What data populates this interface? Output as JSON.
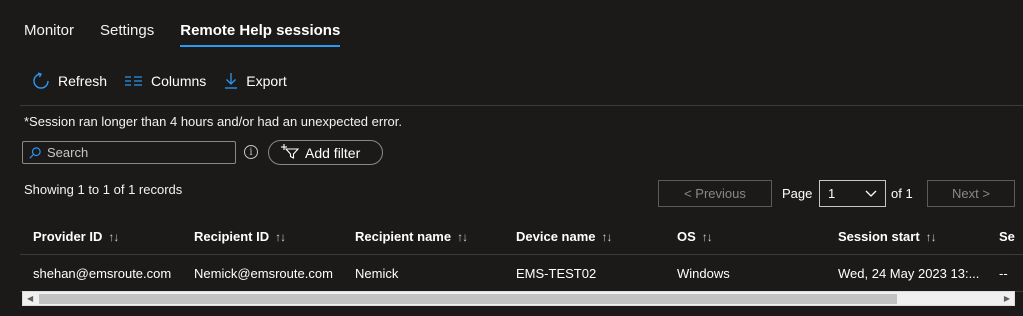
{
  "tabs": [
    {
      "label": "Monitor",
      "active": false
    },
    {
      "label": "Settings",
      "active": false
    },
    {
      "label": "Remote Help sessions",
      "active": true
    }
  ],
  "toolbar": {
    "refresh_label": "Refresh",
    "columns_label": "Columns",
    "export_label": "Export"
  },
  "note": "*Session ran longer than 4 hours and/or had an unexpected error.",
  "search": {
    "placeholder": "Search",
    "value": ""
  },
  "filter": {
    "add_label": "Add filter"
  },
  "records_text": "Showing 1 to 1 of 1 records",
  "pagination": {
    "prev_label": "< Previous",
    "page_label": "Page",
    "current_page": "1",
    "of_label": "of 1",
    "next_label": "Next >"
  },
  "table": {
    "sort_glyph": "↑↓",
    "headers": [
      "Provider ID",
      "Recipient ID",
      "Recipient name",
      "Device name",
      "OS",
      "Session start",
      "Se"
    ],
    "rows": [
      [
        "shehan@emsroute.com",
        "Nemick@emsroute.com",
        "Nemick",
        "EMS-TEST02",
        "Windows",
        "Wed, 24 May 2023 13:...",
        "--"
      ]
    ]
  },
  "colors": {
    "background": "#1b1a19",
    "accent": "#2899f5",
    "border": "#3b3a39"
  },
  "icons": [
    "refresh-icon",
    "columns-icon",
    "export-icon",
    "search-icon",
    "info-icon",
    "filter-icon",
    "chevron-down-icon"
  ]
}
